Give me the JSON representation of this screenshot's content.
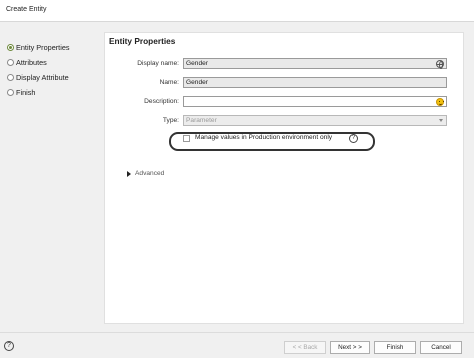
{
  "window": {
    "title": "Create Entity"
  },
  "steps": [
    {
      "label": "Entity Properties",
      "active": true
    },
    {
      "label": "Attributes",
      "active": false
    },
    {
      "label": "Display Attribute",
      "active": false
    },
    {
      "label": "Finish",
      "active": false
    }
  ],
  "content": {
    "heading": "Entity Properties",
    "display_name": {
      "label": "Display name:",
      "value": "Gender",
      "icon": "globe-icon"
    },
    "name": {
      "label": "Name:",
      "value": "Gender"
    },
    "description": {
      "label": "Description:",
      "value": "",
      "icon": "emoji-icon"
    },
    "type": {
      "label": "Type:",
      "value": "Parameter",
      "disabled": true
    },
    "manage_checkbox": {
      "label": "Manage values in Production environment only",
      "checked": false
    },
    "advanced": {
      "label": "Advanced"
    }
  },
  "footer": {
    "help": "?",
    "back": "< < Back",
    "next": "Next > >",
    "finish": "Finish",
    "cancel": "Cancel"
  },
  "colors": {
    "active_step": "#6f8a3e",
    "emoji": "#f2c20f"
  }
}
